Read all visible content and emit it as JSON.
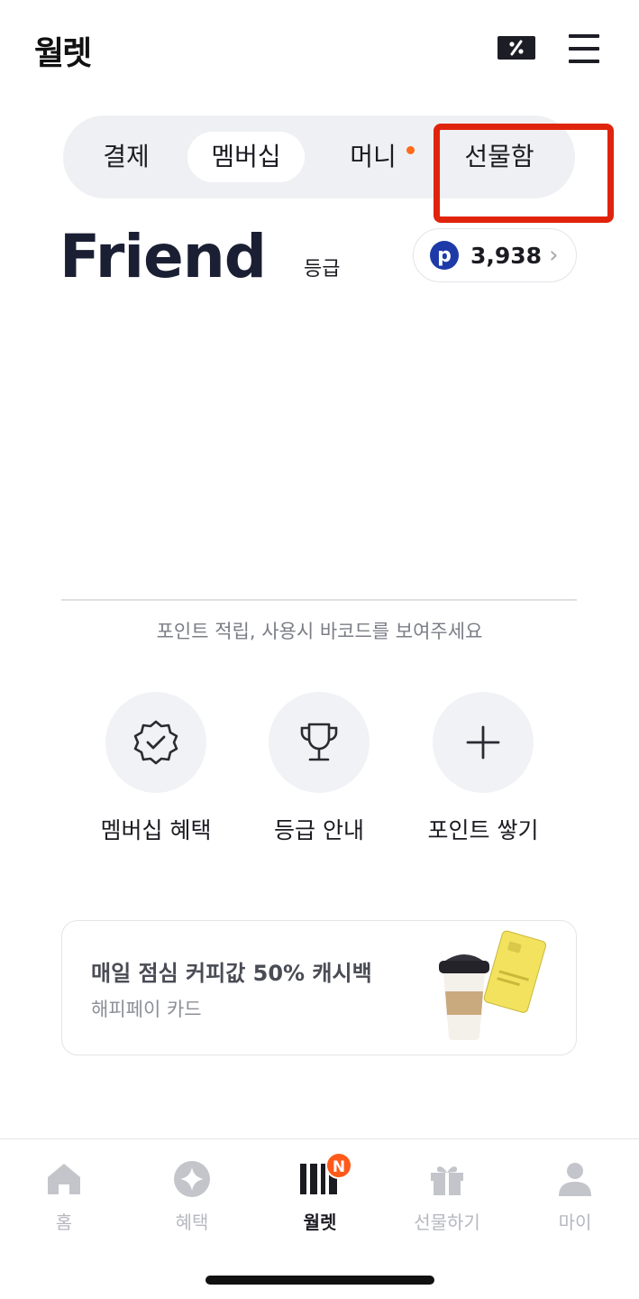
{
  "header": {
    "logo": "월렛",
    "coupon_icon": "coupon-percent-icon",
    "menu_icon": "hamburger-menu-icon"
  },
  "tabs": [
    {
      "label": "결제",
      "selected": false
    },
    {
      "label": "멤버십",
      "selected": true
    },
    {
      "label": "머니",
      "selected": false,
      "has_dot": true
    },
    {
      "label": "선물함",
      "selected": false,
      "highlighted": true
    }
  ],
  "grade": {
    "name": "Friend",
    "suffix": "등급"
  },
  "points": {
    "icon_letter": "p",
    "value": "3,938",
    "chevron": "›"
  },
  "barcode_hint": "포인트 적립, 사용시 바코드를 보여주세요",
  "actions": [
    {
      "label": "멤버십 혜택",
      "icon": "badge-check-icon"
    },
    {
      "label": "등급 안내",
      "icon": "trophy-icon"
    },
    {
      "label": "포인트 쌓기",
      "icon": "plus-icon"
    }
  ],
  "promo": {
    "title": "매일 점심 커피값 50% 캐시백",
    "subtitle": "해피페이 카드"
  },
  "bottom_nav": [
    {
      "label": "홈",
      "icon": "home-icon",
      "active": false
    },
    {
      "label": "혜택",
      "icon": "sparkle-icon",
      "active": false
    },
    {
      "label": "월렛",
      "icon": "wallet-barcode-icon",
      "active": true,
      "badge": "N"
    },
    {
      "label": "선물하기",
      "icon": "gift-icon",
      "active": false
    },
    {
      "label": "마이",
      "icon": "person-icon",
      "active": false
    }
  ],
  "colors": {
    "accent_orange": "#ff5a1a",
    "highlight_red": "#e0240c",
    "point_blue": "#1d3aa8",
    "dark": "#1b1b22"
  }
}
